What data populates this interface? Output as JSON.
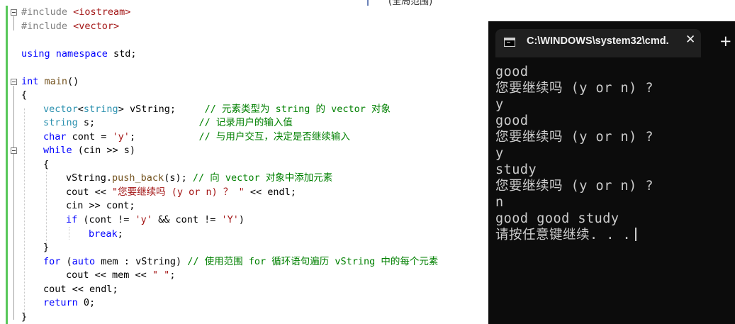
{
  "top_partial_text": "(全局范围)",
  "code": {
    "l1_directive": "#include",
    "l1_header": " <iostream>",
    "l2_directive": "#include",
    "l2_header": " <vector>",
    "l3_kw1": "using",
    "l3_kw2": " namespace",
    "l3_rest": " std;",
    "l4_kw": "int",
    "l4_fn": " main",
    "l4_rest": "()",
    "l5": "{",
    "l6_ty1": "vector",
    "l6_lt": "<",
    "l6_ty2": "string",
    "l6_rest": "> vString;     ",
    "l6_comment": "// 元素类型为 string 的 vector 对象",
    "l7_ty": "string",
    "l7_rest": " s;                  ",
    "l7_comment": "// 记录用户的输入值",
    "l8_kw": "char",
    "l8_rest": " cont = ",
    "l8_str": "'y'",
    "l8_rest2": ";           ",
    "l8_comment": "// 与用户交互，决定是否继续输入",
    "l9_kw": "while",
    "l9_rest": " (cin >> s)",
    "l10": "{",
    "l11_pre": "vString.",
    "l11_fn": "push_back",
    "l11_rest": "(s); ",
    "l11_comment": "// 向 vector 对象中添加元素",
    "l12_pre": "cout << ",
    "l12_str": "\"您要继续吗 (y or n) ？ \"",
    "l12_rest": " << endl;",
    "l13": "cin >> cont;",
    "l14_kw": "if",
    "l14_a": " (cont != ",
    "l14_s1": "'y'",
    "l14_b": " && cont != ",
    "l14_s2": "'Y'",
    "l14_c": ")",
    "l15_kw": "break",
    "l15_rest": ";",
    "l16": "}",
    "l17_kw1": "for",
    "l17_a": " (",
    "l17_kw2": "auto",
    "l17_b": " mem : vString) ",
    "l17_comment": "// 使用范围 for 循环语句遍历 vString 中的每个元素",
    "l18_pre": "cout << mem << ",
    "l18_str": "\" \"",
    "l18_rest": ";",
    "l19": "cout << endl;",
    "l20_kw": "return",
    "l20_rest": " 0;",
    "l21": "}"
  },
  "terminal": {
    "tab_title": "C:\\WINDOWS\\system32\\cmd.",
    "close_glyph": "✕",
    "newtab_glyph": "+",
    "icon": "cmd-icon",
    "lines": [
      "good",
      "您要继续吗 (y or n) ?",
      "y",
      "good",
      "您要继续吗 (y or n) ?",
      "y",
      "study",
      "您要继续吗 (y or n) ?",
      "n",
      "good good study",
      "请按任意键继续. . ."
    ]
  },
  "colors": {
    "keyword": "#0000ff",
    "type": "#2b91af",
    "string": "#a31515",
    "comment": "#008000",
    "preprocessor": "#808080",
    "change_bar": "#58c75a",
    "terminal_bg": "#0c0c0c",
    "terminal_fg": "#cccccc"
  }
}
